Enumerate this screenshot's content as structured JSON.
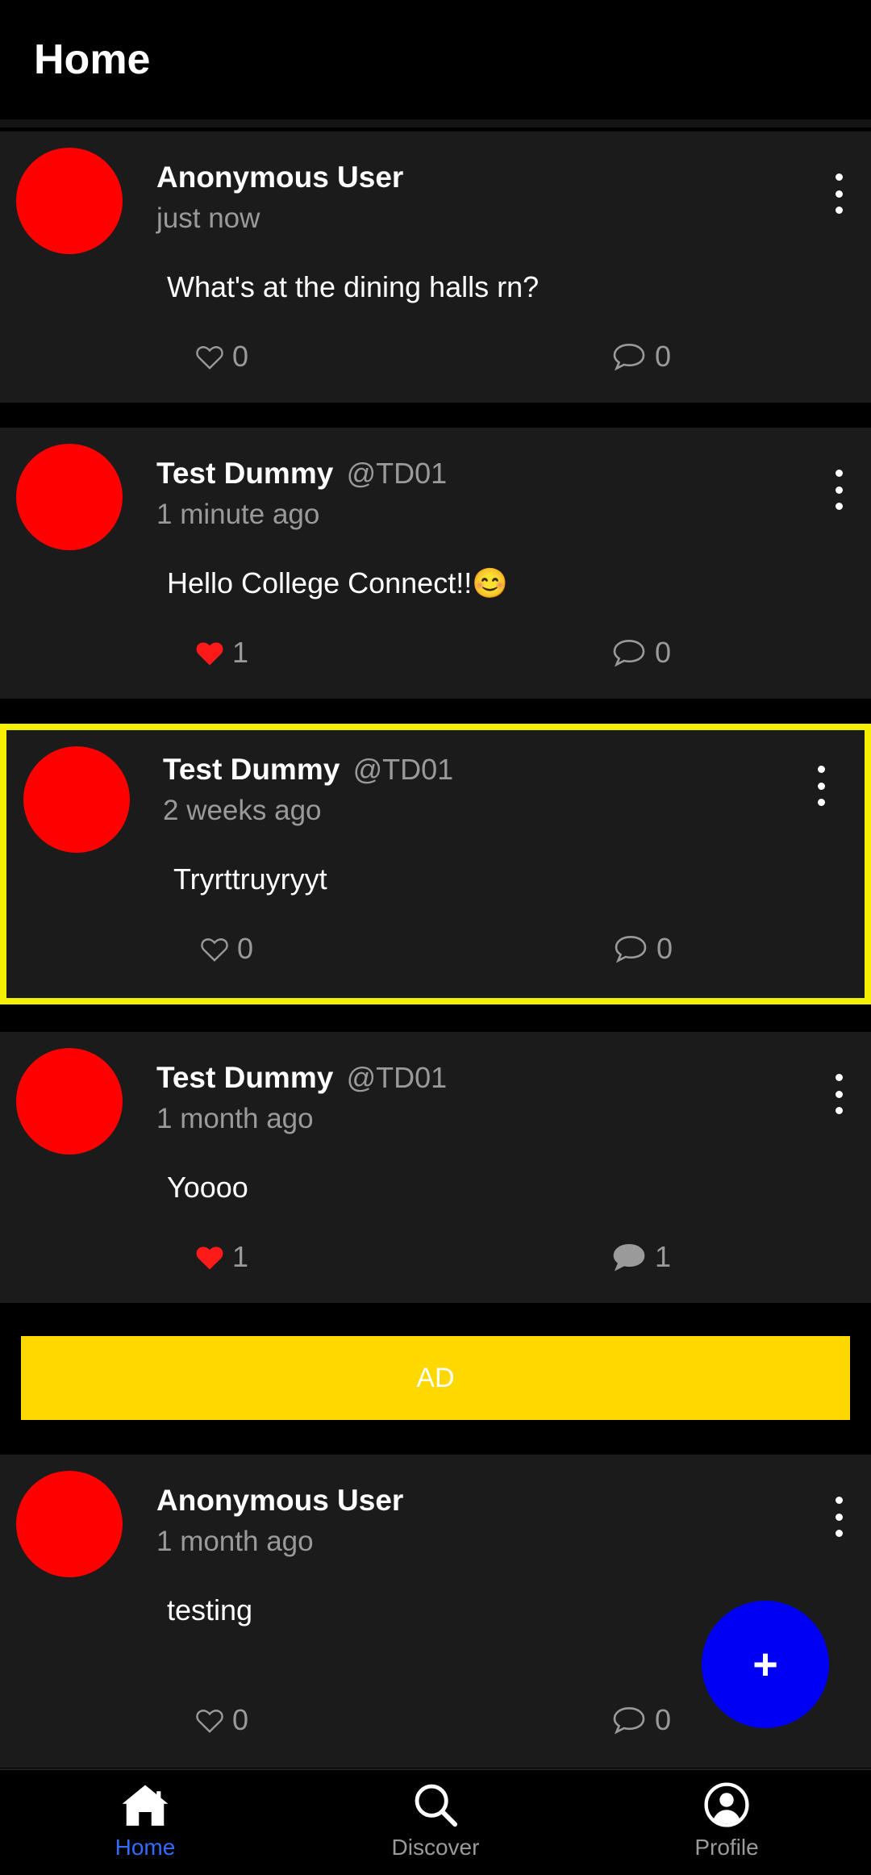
{
  "app": {
    "title": "Home"
  },
  "posts": [
    {
      "name": "Anonymous User",
      "handle": "",
      "time": "just now",
      "content": "What's at the dining halls rn?",
      "likes": "0",
      "comments": "0",
      "liked": false,
      "commented": false
    },
    {
      "name": "Test Dummy",
      "handle": "@TD01",
      "time": "1 minute ago",
      "content": "Hello College Connect!!😊",
      "likes": "1",
      "comments": "0",
      "liked": true,
      "commented": false
    },
    {
      "name": "Test Dummy",
      "handle": "@TD01",
      "time": "2 weeks ago",
      "content": "Tryrttruyryyt",
      "likes": "0",
      "comments": "0",
      "liked": false,
      "commented": false
    },
    {
      "name": "Test Dummy",
      "handle": "@TD01",
      "time": "1 month ago",
      "content": "Yoooo",
      "likes": "1",
      "comments": "1",
      "liked": true,
      "commented": true
    },
    {
      "name": "Anonymous User",
      "handle": "",
      "time": "1 month ago",
      "content": "testing",
      "likes": "0",
      "comments": "0",
      "liked": false,
      "commented": false
    }
  ],
  "ad": {
    "label": "AD"
  },
  "fab": {
    "label": "+"
  },
  "nav": {
    "items": [
      {
        "label": "Home",
        "icon": "home-icon",
        "active": true
      },
      {
        "label": "Discover",
        "icon": "search-icon",
        "active": false
      },
      {
        "label": "Profile",
        "icon": "profile-icon",
        "active": false
      }
    ]
  },
  "colors": {
    "accent": "#2f6cff",
    "fab": "#0000f5",
    "ad": "#ffd800",
    "avatar": "#ff0000",
    "highlight": "#f4f000"
  }
}
